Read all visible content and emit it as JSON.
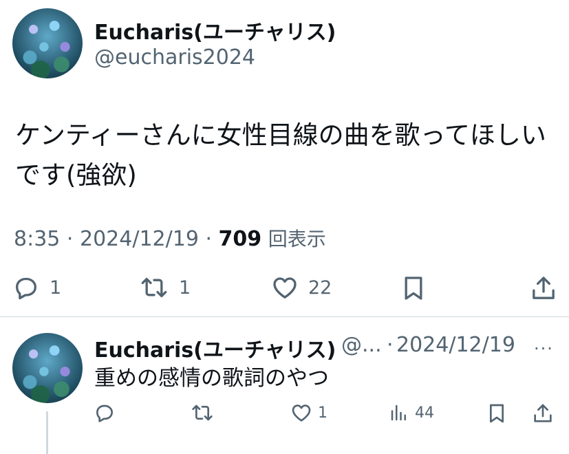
{
  "tweet": {
    "display_name": "Eucharis(ユーチャリス)",
    "handle": "@eucharis2024",
    "text": "ケンティーさんに女性目線の曲を歌ってほしいです(強欲)",
    "time": "8:35",
    "date": "2024/12/19",
    "views_count": "709",
    "views_label": "回表示",
    "replies": "1",
    "retweets": "1",
    "likes": "22"
  },
  "reply": {
    "display_name": "Eucharis(ユーチャリス)",
    "handle_truncated": "@...",
    "date": "2024/12/19",
    "text": "重めの感情の歌詞のやつ",
    "likes": "1",
    "views": "44",
    "more_label": "···"
  },
  "icons": [
    "reply-icon",
    "retweet-icon",
    "like-icon",
    "bookmark-icon",
    "share-icon",
    "views-icon",
    "more-icon"
  ]
}
